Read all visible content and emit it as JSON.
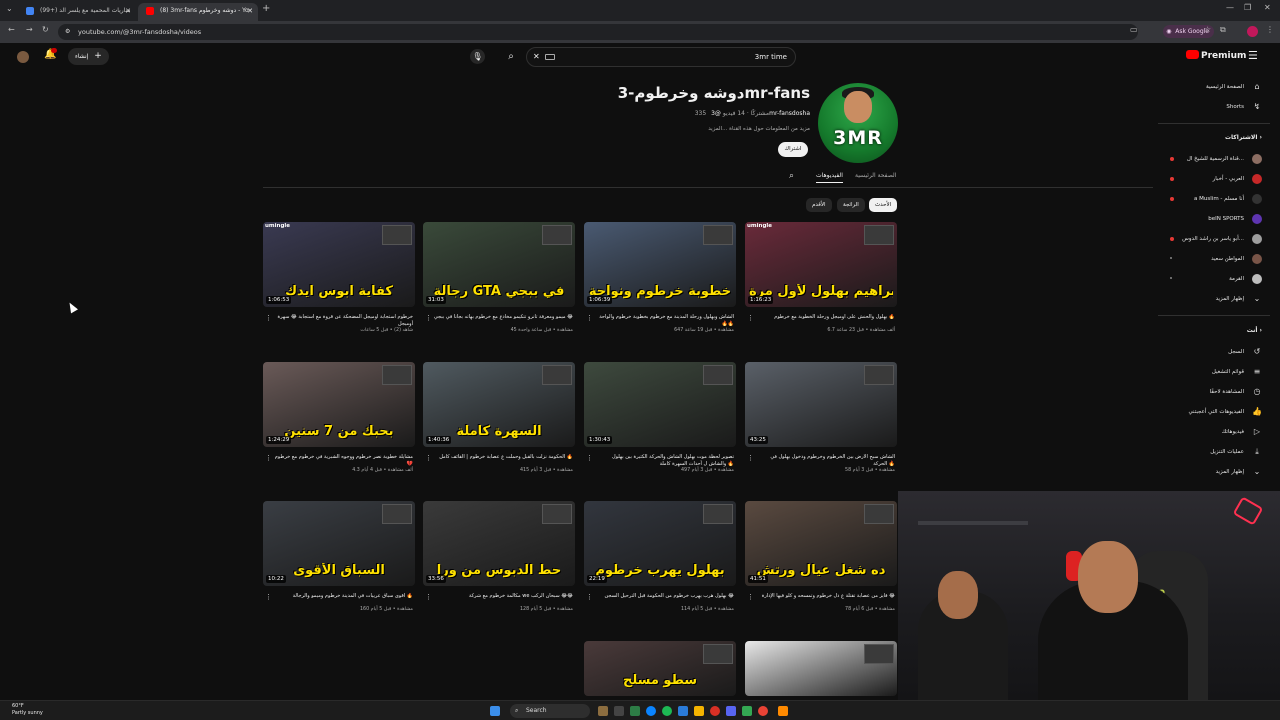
{
  "browser": {
    "tabs": [
      {
        "label": "(99+) مباريات المحمية مع يلسر الد",
        "active": false,
        "favicon_color": "#4285f4"
      },
      {
        "label": "(8) 3mr-fans دوشه وخرطوم - Yo",
        "active": true,
        "favicon_color": "#ff0000"
      }
    ],
    "new_tab": "+",
    "url": "youtube.com/@3mr-fansdosha/videos",
    "ask_google": "Ask Google"
  },
  "header": {
    "search_value": "3mr time",
    "create_label": "إنشاء",
    "premium_label": "Premium",
    "notifications": "9+"
  },
  "sidebar": {
    "top": [
      {
        "label": "الصفحة الرئيسية",
        "icon": "home-icon"
      },
      {
        "label": "Shorts",
        "icon": "shorts-icon"
      }
    ],
    "subs_heading": "الاشتراكات",
    "subscriptions": [
      {
        "label": "قناة الرسمية للشيخ ال...",
        "color": "#8d6e63",
        "live": true
      },
      {
        "label": "العربي - أخبار",
        "color": "#c62828",
        "live": true
      },
      {
        "label": "a Muslim - أنا مسلم",
        "color": "#333333",
        "live": true
      },
      {
        "label": "beIN SPORTS",
        "color": "#5e35b1",
        "live": false
      },
      {
        "label": "أبو ياسر بن راشد الدوس...",
        "color": "#9e9e9e",
        "live": true
      },
      {
        "label": "المواطن سعيد",
        "color": "#795548",
        "live": false
      },
      {
        "label": "القرمة",
        "color": "#bdbdbd",
        "live": false
      }
    ],
    "subs_more": "إظهار المزيد",
    "you_heading": "أنت",
    "you_items": [
      {
        "label": "السجل",
        "icon": "history-icon"
      },
      {
        "label": "قوائم التشغيل",
        "icon": "playlist-icon"
      },
      {
        "label": "المشاهدة لاحقًا",
        "icon": "clock-icon"
      },
      {
        "label": "الفيديوهات التي أعجبتني",
        "icon": "like-icon"
      },
      {
        "label": "فيديوهاتك",
        "icon": "video-icon"
      },
      {
        "label": "عمليات التنزيل",
        "icon": "download-icon"
      }
    ],
    "you_more": "إظهار المزيد"
  },
  "channel": {
    "name": "دوشه وخرطوم-3mr-fans",
    "handle": "@3mr-fansdosha",
    "stats": "335 مشتركًا ‧ 14 فيديو",
    "description": "مزيد من المعلومات حول هذه القناة ...المزيد",
    "subscribe_label": "اشتراك",
    "avatar_text": "3MR",
    "tabs": [
      "الصفحة الرئيسية",
      "الفيديوهات"
    ],
    "active_tab": "الفيديوهات",
    "chips": [
      "الأحدث",
      "الرائجة",
      "الأقدم"
    ]
  },
  "videos": [
    {
      "thumb_text": "ابراهيم بهلول لأول مرة",
      "umingle": "umingle",
      "duration": "1:16:23",
      "title": "بهلول والحنش على أوميجل ورحلة الخطوبة مع خرطوم 🔥",
      "meta": "6.7 ألف مشاهدة • قبل 23 ساعة",
      "bg": "#6a2a3a"
    },
    {
      "thumb_text": "خطوبة خرطوم ونواحة",
      "umingle": "",
      "duration": "1:06:39",
      "title": "الشاش وبهلول ورحلة المدينة مع خرطوم بخطوبة خرطوم والواحة 🔥🔥",
      "meta": "647 مشاهدة • قبل 19 ساعة",
      "bg": "#4a5a72"
    },
    {
      "thumb_text": "رجالة GTA في ببجي",
      "umingle": "",
      "duration": "31:03",
      "title": "ميمو ومعرفة تانرو تتكيمو مخادع مع خرطوم بهاته بجانا في ببجي 😂",
      "meta": "45 مشاهدة • قبل ساعة واحدة",
      "bg": "#3a4a3a"
    },
    {
      "thumb_text": "كفاية ابوس ايدك",
      "umingle": "umingle",
      "duration": "1:06:53",
      "title": "خرطوم أستجابة أوميجل المضحكة عن قروة مع استجابة 😂 سهرة أوميجل",
      "meta": "شاهد (2) • قبل 5 ساعات",
      "bg": "#3a3a52"
    },
    {
      "thumb_text": "",
      "umingle": "",
      "duration": "43:25",
      "title": "الشاش سبح الأرض بين الخرطوم وخرطوم ودخول بهلول في الحركة 🔥",
      "meta": "58 مشاهدة • قبل 3 أيام",
      "bg": "#5a6068"
    },
    {
      "thumb_text": "",
      "umingle": "",
      "duration": "1:30:43",
      "title": "تصوير لحظة موت بهلول الشاش والحركة الكثيرة بين بهلول والشاش ل أحداث السهرة كاملة 🔥",
      "meta": "497 مشاهدة • قبل 3 أيام",
      "bg": "#3e4a3e"
    },
    {
      "thumb_text": "السهرة كاملة",
      "umingle": "",
      "duration": "1:40:36",
      "title": "الحكومة نزلت بالقبل وحملت ع عصابة خرطوم | القائف كامل 🔥",
      "meta": "415 مشاهدة • قبل 3 أيام",
      "bg": "#505a60"
    },
    {
      "thumb_text": "بحبك من 7 سنين",
      "umingle": "",
      "duration": "1:24:29",
      "title": "مشايلة خطوبة نصر خرطوم ووجوه الشبرية في خرطوم مع خرطوم 💔",
      "meta": "4.3 ألف مشاهدة • قبل 4 أيام",
      "bg": "#6a5a58"
    },
    {
      "thumb_text": "ده شغل عيال ورتش",
      "umingle": "",
      "duration": "41:51",
      "title": "فايز من عصابة تقتلة ع ذل خرطوم وتمسحه و كلو فيها الإدارة 😂",
      "meta": "78 مشاهدة • قبل 6 أيام",
      "bg": "#5a4a40"
    },
    {
      "thumb_text": "بهلول يهرب خرطوم",
      "umingle": "",
      "duration": "22:19",
      "title": "بهلول هرب يهرب خرطوم من الحكومة قبل الترحيل السجن 😂",
      "meta": "114 مشاهدة • قبل 5 أيام",
      "bg": "#32363e"
    },
    {
      "thumb_text": "حط الدبوس من ورا",
      "umingle": "",
      "duration": "33:56",
      "title": "مكالمة خرطوم مع شركة we سبحان الركب 😂😂",
      "meta": "128 مشاهدة • قبل 5 أيام",
      "bg": "#3a3a3a"
    },
    {
      "thumb_text": "السباق الأقوى",
      "umingle": "",
      "duration": "10:22",
      "title": "أقوى سباق عربيات في المدينة خرطوم وميمو والرجالة 🔥",
      "meta": "160 مشاهدة • قبل 5 أيام",
      "bg": "#3a3e44"
    },
    {
      "thumb_text": "",
      "umingle": "",
      "duration": "",
      "title": "",
      "meta": "",
      "bg": "#e8e8e8"
    },
    {
      "thumb_text": "سطو مسلح",
      "umingle": "",
      "duration": "",
      "title": "",
      "meta": "",
      "bg": "#4a3a3a"
    }
  ],
  "taskbar": {
    "weather_temp": "60°F",
    "weather_desc": "Partly sunny",
    "search_label": "Search"
  }
}
